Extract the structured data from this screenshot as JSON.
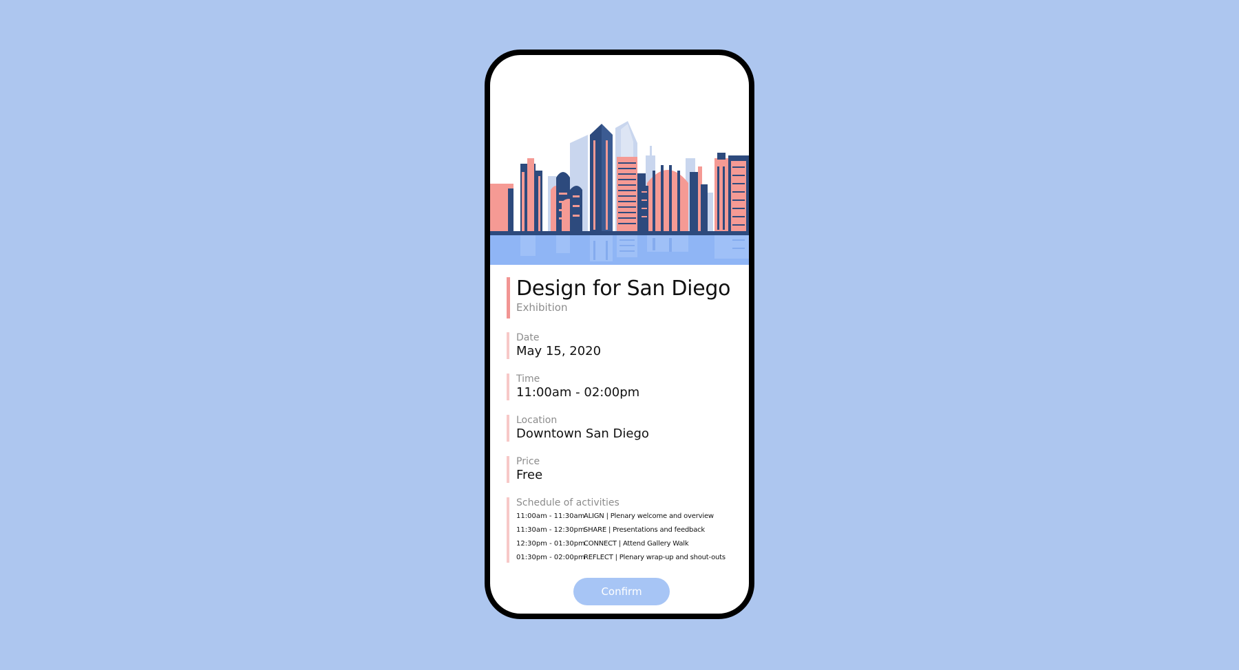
{
  "event": {
    "title": "Design for San Diego",
    "type": "Exhibition"
  },
  "fields": [
    {
      "label": "Date",
      "value": "May 15, 2020"
    },
    {
      "label": "Time",
      "value": "11:00am - 02:00pm"
    },
    {
      "label": "Location",
      "value": "Downtown San Diego"
    },
    {
      "label": "Price",
      "value": "Free"
    }
  ],
  "schedule": {
    "label": "Schedule of activities",
    "items": [
      {
        "time": "11:00am - 11:30am",
        "activity": "ALIGN | Plenary welcome and overview"
      },
      {
        "time": "11:30am - 12:30pm",
        "activity": "SHARE | Presentations and feedback"
      },
      {
        "time": "12:30pm - 01:30pm",
        "activity": "CONNECT | Attend Gallery Walk"
      },
      {
        "time": "01:30pm - 02:00pm",
        "activity": "REFLECT | Plenary wrap-up and shout-outs"
      }
    ]
  },
  "actions": {
    "confirm_label": "Confirm"
  },
  "colors": {
    "background": "#adc6ef",
    "accent_bar": "#f29593",
    "accent_bar_light": "#f7c9c8",
    "skyline_navy": "#2d4a7d",
    "skyline_coral": "#f59a94",
    "water": "#8fb5f5",
    "button": "#a7c5f5"
  },
  "icons": {
    "hero": "san-diego-skyline-illustration"
  }
}
